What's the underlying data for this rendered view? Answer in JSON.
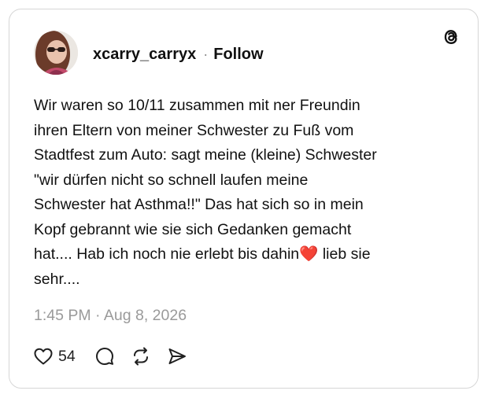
{
  "post": {
    "username": "xcarry_carryx",
    "separator": "·",
    "follow_label": "Follow",
    "text_lines": [
      "Wir waren so 10/11 zusammen mit ner Freundin",
      "ihren Eltern  von meiner Schwester zu Fuß vom",
      "Stadtfest zum Auto: sagt meine (kleine) Schwester",
      "\"wir dürfen nicht so schnell laufen meine",
      "Schwester hat Asthma!!\" Das hat sich so in mein",
      "Kopf gebrannt wie sie sich Gedanken gemacht",
      "hat.... Hab ich noch nie erlebt bis dahin",
      "sehr...."
    ],
    "emoji": "❤️",
    "line7_after_emoji": " lieb sie",
    "timestamp": "1:45 PM · Aug 8, 2026",
    "like_count": "54"
  },
  "icons": {
    "brand": "threads-logo-icon",
    "like": "heart-icon",
    "reply": "comment-bubble-icon",
    "repost": "repost-icon",
    "share": "send-icon"
  },
  "colors": {
    "text": "#111111",
    "muted": "#9a9a9a",
    "border": "#d6d6d6",
    "emoji_heart": "#e0283a"
  }
}
